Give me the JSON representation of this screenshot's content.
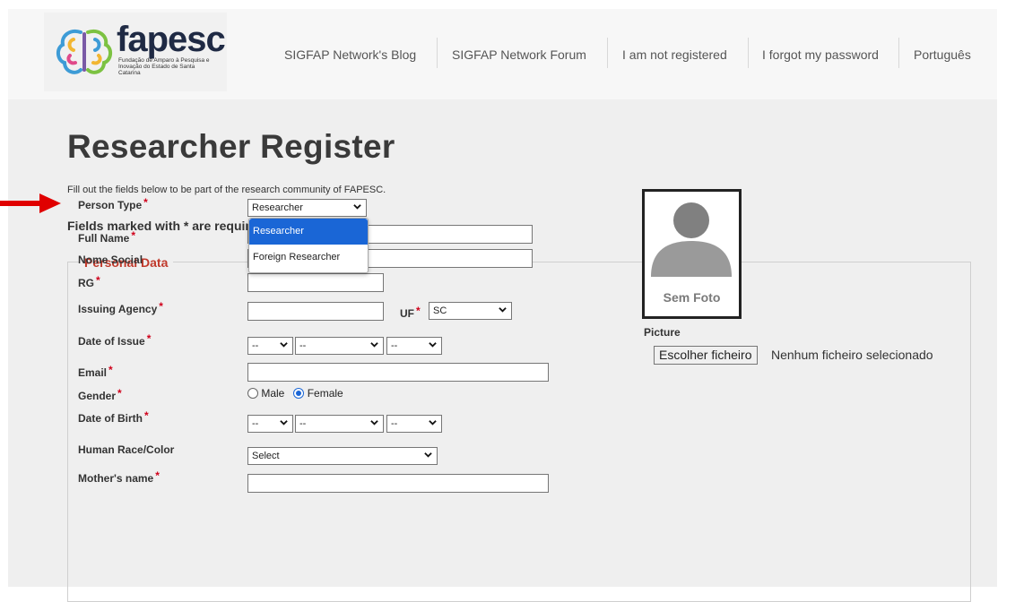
{
  "header": {
    "logo_brand": "fapesc",
    "logo_tagline": "Fundação de Amparo à Pesquisa e Inovação do Estado de Santa Catarina",
    "nav": [
      {
        "label": "SIGFAP Network's Blog"
      },
      {
        "label": "SIGFAP Network Forum"
      },
      {
        "label": "I am not registered"
      },
      {
        "label": "I forgot my password"
      },
      {
        "label": "Português"
      }
    ]
  },
  "page": {
    "title": "Researcher Register",
    "intro": "Fill out the fields below to be part of the research community of FAPESC.",
    "required_note": "Fields marked with * are required.",
    "legend": "Personal Data",
    "required_marker": "*"
  },
  "form": {
    "person_type": {
      "label": "Person Type",
      "value": "Researcher",
      "options": [
        "Researcher",
        "Foreign Researcher"
      ]
    },
    "full_name": {
      "label": "Full Name"
    },
    "nome_social": {
      "label": "Nome Social"
    },
    "rg": {
      "label": "RG"
    },
    "issuing_agency": {
      "label": "Issuing Agency",
      "uf_label": "UF",
      "uf_value": "SC"
    },
    "date_of_issue": {
      "label": "Date of Issue",
      "day": "--",
      "month": "--",
      "year": "--"
    },
    "email": {
      "label": "Email"
    },
    "gender": {
      "label": "Gender",
      "options": [
        "Male",
        "Female"
      ],
      "selected": "Female"
    },
    "date_of_birth": {
      "label": "Date of Birth",
      "day": "--",
      "month": "--",
      "year": "--"
    },
    "race": {
      "label": "Human Race/Color",
      "value": "Select"
    },
    "mother_name": {
      "label": "Mother's name"
    }
  },
  "photo": {
    "placeholder": "Sem Foto",
    "picture_label": "Picture",
    "file_button": "Escolher ficheiro",
    "file_status": "Nenhum ficheiro selecionado"
  },
  "colors": {
    "accent_red": "#c0392b",
    "required_red": "#d0021b",
    "highlight_blue": "#1a66d6",
    "arrow_red": "#e00000"
  }
}
